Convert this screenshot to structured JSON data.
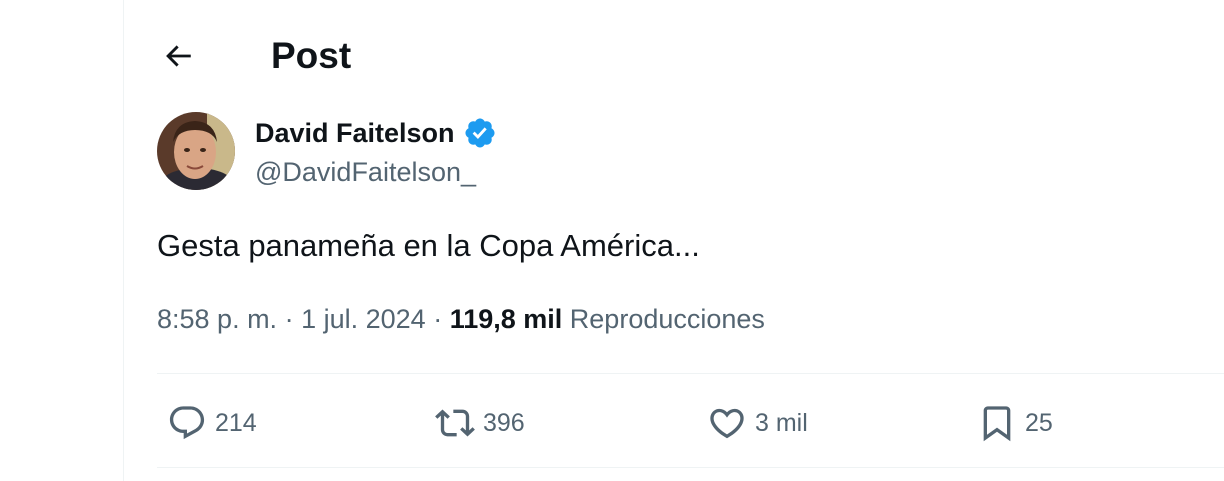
{
  "header": {
    "title": "Post",
    "back_icon": "arrow-left-icon"
  },
  "author": {
    "display_name": "David Faitelson",
    "handle": "@DavidFaitelson_",
    "verified_icon": "verified-badge-icon",
    "verified_color": "#1d9bf0"
  },
  "tweet": {
    "text": "Gesta panameña en la Copa América..."
  },
  "meta": {
    "time": "8:58 p. m.",
    "separator1": " · ",
    "date": "1 jul. 2024",
    "separator2": " · ",
    "views_count": "119,8 mil",
    "views_label": "Reproducciones"
  },
  "actions": {
    "replies": {
      "icon": "reply-icon",
      "count": "214"
    },
    "reposts": {
      "icon": "repost-icon",
      "count": "396"
    },
    "likes": {
      "icon": "heart-icon",
      "count": "3 mil"
    },
    "bookmarks": {
      "icon": "bookmark-icon",
      "count": "25"
    }
  },
  "colors": {
    "primary_text": "#0f1419",
    "secondary_text": "#536471",
    "divider": "#eff3f4",
    "accent": "#1d9bf0"
  }
}
